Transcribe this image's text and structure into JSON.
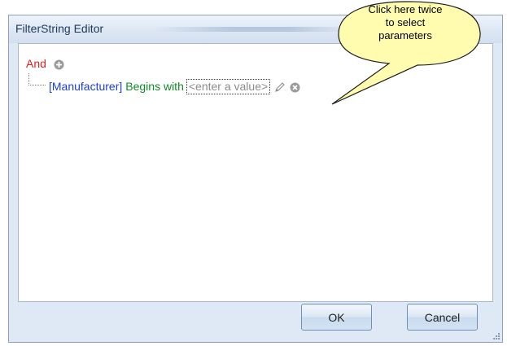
{
  "window": {
    "title": "FilterString Editor"
  },
  "filter": {
    "group_operator": "And",
    "condition": {
      "field": "[Manufacturer]",
      "operation": "Begins with",
      "value_placeholder": "<enter a value>"
    }
  },
  "buttons": {
    "ok_label": "OK",
    "cancel_label": "Cancel"
  },
  "callout": {
    "line1": "Click here twice",
    "line2": "to select",
    "line3": "parameters"
  },
  "colors": {
    "group_operator": "#e02020",
    "field": "#1c3fd6",
    "operation": "#118a28",
    "value": "#8c8c8c",
    "callout_fill": "#fffcb0"
  },
  "icons": [
    "add-condition-icon",
    "pencil-icon",
    "remove-condition-icon",
    "resize-grip-icon"
  ]
}
